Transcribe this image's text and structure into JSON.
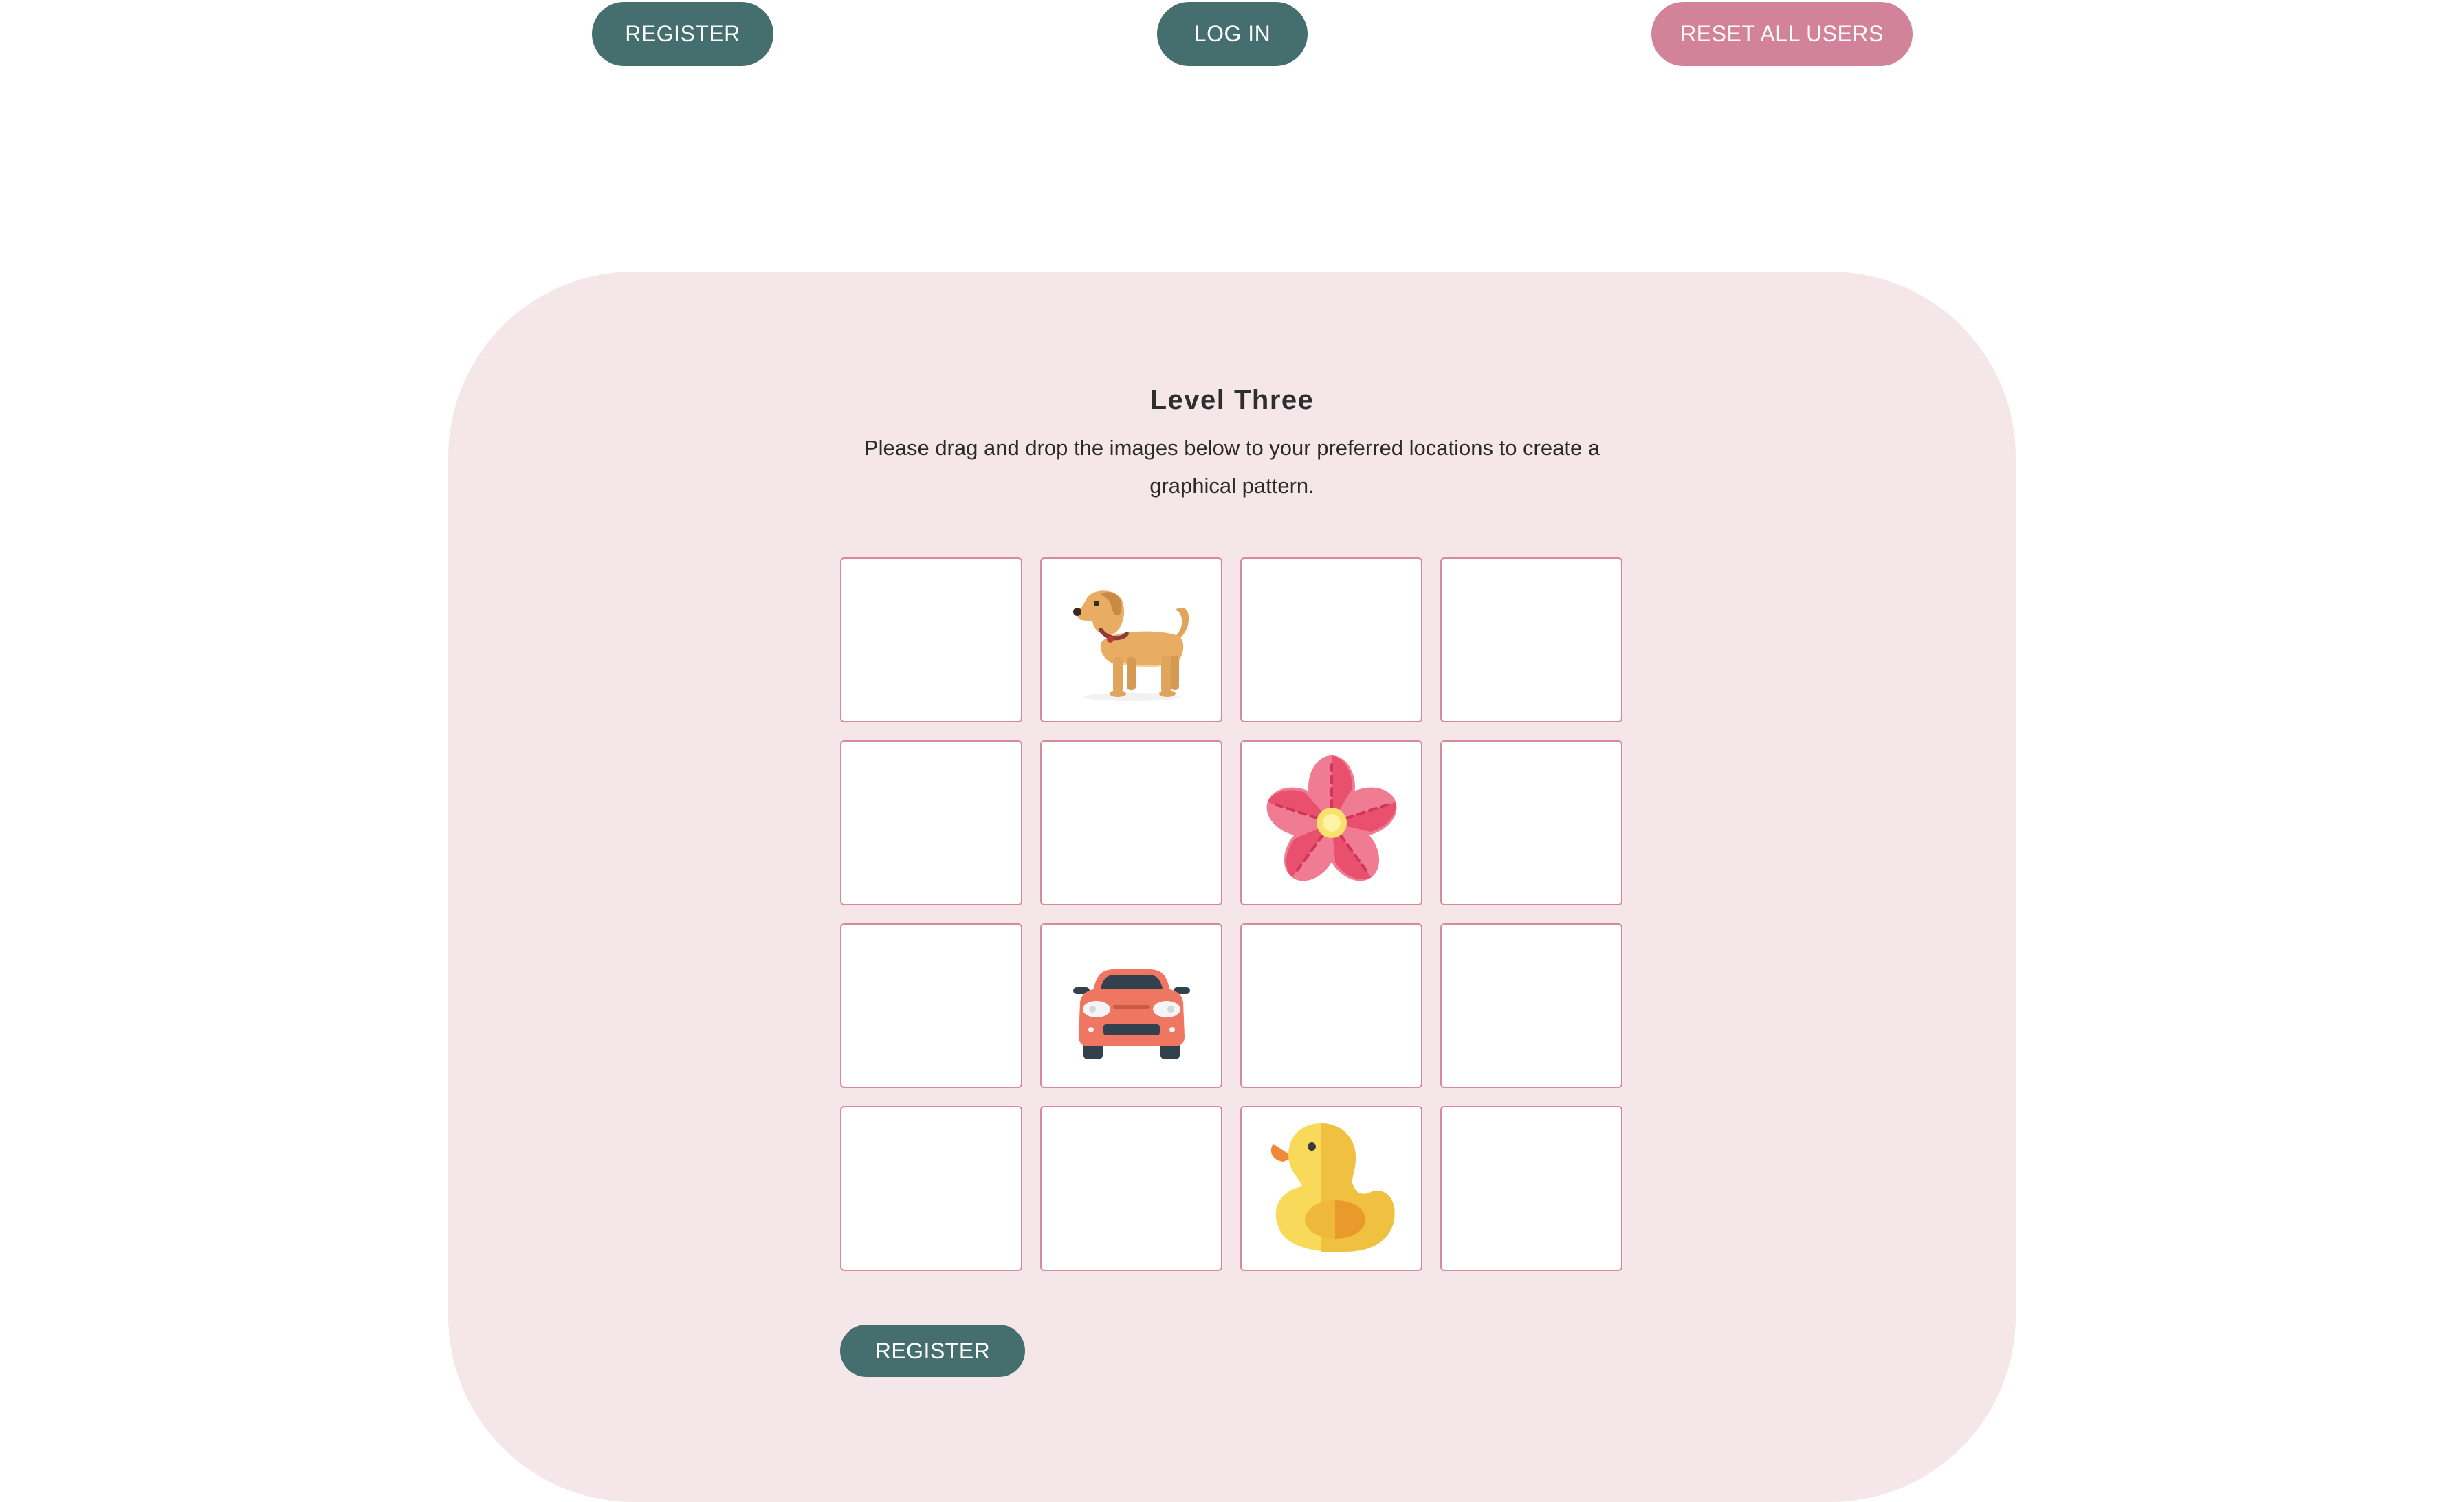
{
  "header": {
    "register_label": "REGISTER",
    "login_label": "LOG IN",
    "reset_label": "RESET ALL USERS"
  },
  "colors": {
    "primary": "#456e6e",
    "danger": "#d38399",
    "panel": "#f5e6ea",
    "cell_border": "#d8899b"
  },
  "level": {
    "title": "Level Three",
    "instructions": "Please drag and drop the images below to your preferred locations to create a graphical pattern."
  },
  "grid": {
    "rows": 4,
    "cols": 4,
    "cells": [
      "",
      "dog-icon",
      "",
      "",
      "",
      "",
      "flower-icon",
      "",
      "",
      "car-icon",
      "",
      "",
      "",
      "",
      "duck-icon",
      ""
    ]
  },
  "footer": {
    "register_label": "REGISTER"
  }
}
